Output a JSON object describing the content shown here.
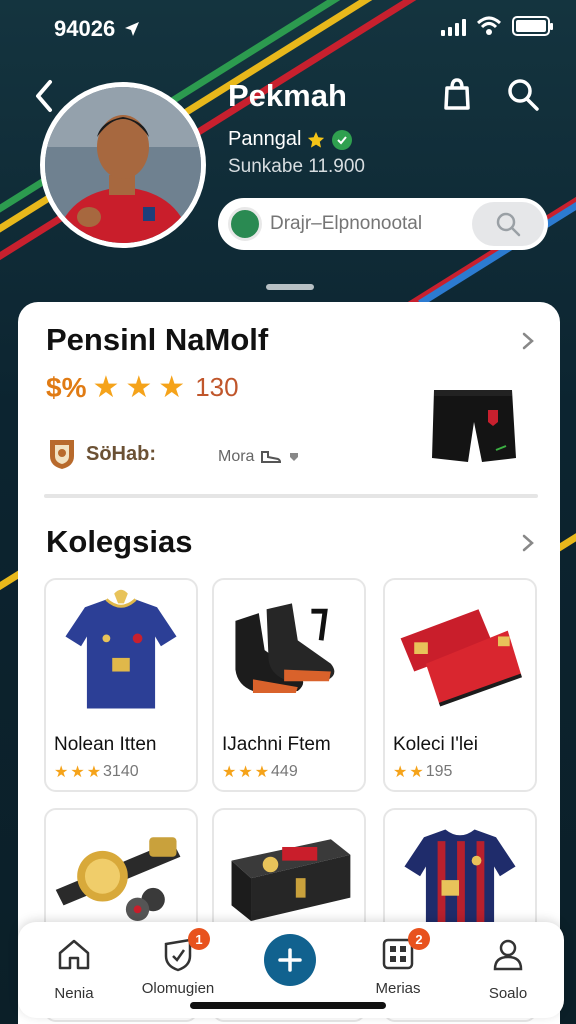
{
  "status": {
    "time": "94026"
  },
  "header": {
    "name": "Pekmah",
    "subtitle": "Panngal",
    "meta": "Sunkabe 11.900",
    "search_placeholder": "Drajr–Elpnonootal"
  },
  "featured": {
    "title": "Pensinl NaMolf",
    "price": "$%",
    "stars": 3,
    "rating_count": "130",
    "badge_label": "SöHab:",
    "more_label": "Mora"
  },
  "collections": {
    "title": "Kolegsias",
    "items": [
      {
        "name": "Nolean Itten",
        "rating": "3140",
        "stars": 3
      },
      {
        "name": "IJachni Ftem",
        "rating": "449",
        "stars": 3
      },
      {
        "name": "Koleci I'lei",
        "rating": "195",
        "stars": 2
      },
      {
        "name": "",
        "rating": "",
        "stars": 0
      },
      {
        "name": "",
        "rating": "",
        "stars": 0
      },
      {
        "name": "",
        "rating": "",
        "stars": 0
      }
    ]
  },
  "nav": {
    "items": [
      {
        "label": "Nenia",
        "icon": "home-icon"
      },
      {
        "label": "Olomugien",
        "icon": "shield-icon",
        "badge": "1"
      },
      {
        "label": "",
        "icon": "plus-icon"
      },
      {
        "label": "Merias",
        "icon": "grid-icon",
        "badge": "2"
      },
      {
        "label": "Soalo",
        "icon": "user-icon"
      }
    ]
  },
  "colors": {
    "accent": "#11628f",
    "star": "#f5a31a",
    "price": "#e07b14",
    "badge": "#e8521e",
    "bg": "#0c2430"
  }
}
